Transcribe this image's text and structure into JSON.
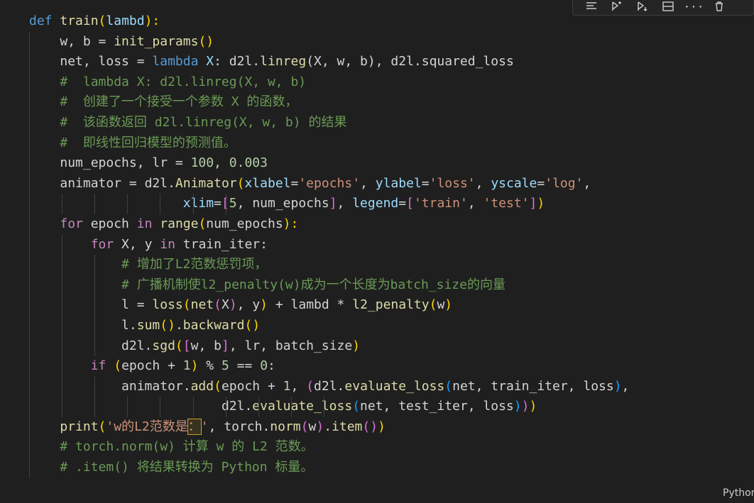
{
  "toolbar": {
    "icons": [
      "list-icon",
      "run-above-icon",
      "run-below-icon",
      "split-cell-icon",
      "more-icon",
      "delete-icon"
    ],
    "more_label": "···"
  },
  "status": {
    "language": "Python"
  },
  "code": {
    "l1": {
      "a": "def",
      "b": "train",
      "c": "(",
      "d": "lambd",
      "e": "):"
    },
    "l2": {
      "a": "w, b = ",
      "b": "init_params",
      "c": "()"
    },
    "l3": {
      "a": "net, loss = ",
      "b": "lambda",
      "c": "X",
      "d": ": d2l.",
      "e": "linreg",
      "f": "(X, w, b), d2l.squared_loss"
    },
    "l4": "#  lambda X: d2l.linreg(X, w, b)",
    "l5": "#  创建了一个接受一个参数 X 的函数，",
    "l6": "#  该函数返回 d2l.linreg(X, w, b) 的结果",
    "l7": "#  即线性回归模型的预测值。",
    "l8": {
      "a": "num_epochs, lr = ",
      "b": "100",
      "c": ", ",
      "d": "0.003"
    },
    "l9": {
      "a": "animator = d2l.",
      "b": "Animator",
      "c": "(",
      "d": "xlabel",
      "e": "=",
      "f": "'epochs'",
      "g": ", ",
      "h": "ylabel",
      "i": "=",
      "j": "'loss'",
      "k": ", ",
      "l": "yscale",
      "m": "=",
      "n": "'log'",
      "o": ","
    },
    "l10": {
      "a": "xlim",
      "b": "=",
      "c": "[",
      "d": "5",
      "e": ", num_epochs",
      "f": "]",
      "g": ", ",
      "h": "legend",
      "i": "=",
      "j": "[",
      "k": "'train'",
      "l": ", ",
      "m": "'test'",
      "n": "]",
      "o": ")"
    },
    "l11": {
      "a": "for",
      "b": " epoch ",
      "c": "in",
      "d": " ",
      "e": "range",
      "f": "(",
      "g": "num_epochs",
      "h": "):"
    },
    "l12": {
      "a": "for",
      "b": " X, y ",
      "c": "in",
      "d": " train_iter:"
    },
    "l13": "# 增加了L2范数惩罚项，",
    "l14": "# 广播机制使l2_penalty(w)成为一个长度为batch_size的向量",
    "l15": {
      "a": "l = ",
      "b": "loss",
      "c": "(",
      "d": "net",
      "e": "(",
      "f": "X",
      "g": ")",
      "h": ", y",
      "i": ")",
      "j": " + lambd * ",
      "k": "l2_penalty",
      "l": "(",
      "m": "w",
      "n": ")"
    },
    "l16": {
      "a": "l.",
      "b": "sum",
      "c": "()",
      "d": ".",
      "e": "backward",
      "f": "()"
    },
    "l17": {
      "a": "d2l.",
      "b": "sgd",
      "c": "(",
      "d": "[",
      "e": "w, b",
      "f": "]",
      "g": ", lr, batch_size",
      "h": ")"
    },
    "l18": {
      "a": "if",
      "b": " ",
      "c": "(",
      "d": "epoch + ",
      "e": "1",
      "f": ")",
      "g": " % ",
      "h": "5",
      "i": " == ",
      "j": "0",
      "k": ":"
    },
    "l19": {
      "a": "animator.",
      "b": "add",
      "c": "(",
      "d": "epoch + ",
      "e": "1",
      "f": ", ",
      "g": "(",
      "h": "d2l.",
      "i": "evaluate_loss",
      "j": "(",
      "k": "net, train_iter, loss",
      "l": ")",
      "m": ","
    },
    "l20": {
      "a": "d2l.",
      "b": "evaluate_loss",
      "c": "(",
      "d": "net, test_iter, loss",
      "e": ")",
      "f": ")",
      "g": ")"
    },
    "l21": {
      "a": "print",
      "b": "(",
      "c": "'w的L2范数是",
      "d": "：",
      "e": "'",
      "f": ", torch.",
      "g": "norm",
      "h": "(",
      "i": "w",
      "j": ")",
      "k": ".",
      "l": "item",
      "m": "()",
      "n": ")"
    },
    "l22": "# torch.norm(w) 计算 w 的 L2 范数。",
    "l23": "# .item() 将结果转换为 Python 标量。"
  }
}
